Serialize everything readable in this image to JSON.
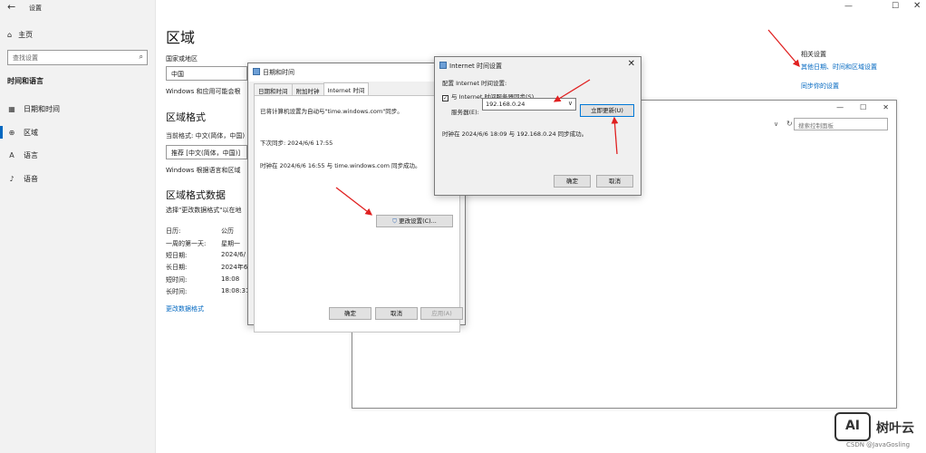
{
  "settings": {
    "window_title": "设置",
    "home": "主页",
    "search_placeholder": "查找设置",
    "group": "时间和语言",
    "nav": [
      "日期和时间",
      "区域",
      "语言",
      "语音"
    ],
    "region_title": "区域",
    "country_label": "国家或地区",
    "country_value": "中国",
    "country_note": "Windows 和应用可能会根",
    "format_title": "区域格式",
    "current_format": "当前格式: 中文(简体，中国)",
    "format_combo": "推荐 [中文(简体，中国)]",
    "format_note": "Windows 根据语言和区域",
    "data_title": "区域格式数据",
    "data_note": "选择\"更改数据格式\"以在地",
    "data_rows": [
      {
        "label": "日历:",
        "value": "公历"
      },
      {
        "label": "一周的第一天:",
        "value": "星期一"
      },
      {
        "label": "短日期:",
        "value": "2024/6/"
      },
      {
        "label": "长日期:",
        "value": "2024年6"
      },
      {
        "label": "短时间:",
        "value": "18:08"
      },
      {
        "label": "长时间:",
        "value": "18:08:31"
      }
    ],
    "change_link": "更改数据格式",
    "related_title": "相关设置",
    "related_links": [
      "其他日期、时间和区域设置",
      "同步你的设置"
    ]
  },
  "control_panel": {
    "search_placeholder": "搜索控制面板"
  },
  "datetime_dialog": {
    "title": "日期和时间",
    "tabs": [
      "日期和时间",
      "附加时钟",
      "Internet 时间"
    ],
    "line1": "已将计算机设置为自动与\"time.windows.com\"同步。",
    "line2": "下次同步: 2024/6/6 17:55",
    "line3": "时钟在 2024/6/6 16:55 与 time.windows.com 同步成功。",
    "change_button": "更改设置(C)...",
    "ok": "确定",
    "cancel": "取消",
    "apply": "应用(A)"
  },
  "internet_dialog": {
    "title": "Internet 时间设置",
    "config_label": "配置 Internet 时间设置:",
    "sync_checkbox": "与 Internet 时间服务器同步(S)",
    "checked": true,
    "server_label": "服务器(E):",
    "server_value": "192.168.0.24",
    "update_button": "立即更新(U)",
    "status": "时钟在 2024/6/6 18:09 与 192.168.0.24 同步成功。",
    "ok": "确定",
    "cancel": "取消"
  },
  "watermark": {
    "logo": "AI",
    "brand": "树叶云",
    "credit": "CSDN @JavaGosling"
  },
  "colors": {
    "accent": "#0067c0",
    "arrow": "#e02020"
  }
}
